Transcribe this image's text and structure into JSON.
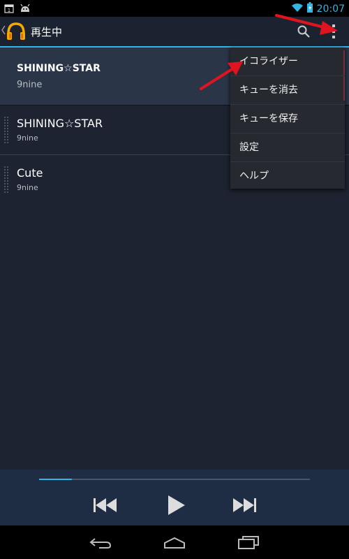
{
  "status_bar": {
    "time": "20:07",
    "notification_icons": [
      "calendar-icon",
      "android-icon"
    ],
    "system_icons": [
      "wifi-icon",
      "battery-charging-icon"
    ]
  },
  "action_bar": {
    "title": "再生中",
    "app_icon": "headphones-icon",
    "search_icon": "search-icon",
    "overflow_icon": "overflow-menu-icon"
  },
  "queue": [
    {
      "title": "SHINING☆STAR",
      "artist": "9nine",
      "playing": true
    },
    {
      "title": "SHINING☆STAR",
      "artist": "9nine",
      "playing": false
    },
    {
      "title": "Cute",
      "artist": "9nine",
      "playing": false
    }
  ],
  "overflow_menu": {
    "items": [
      {
        "label": "イコライザー"
      },
      {
        "label": "キューを消去"
      },
      {
        "label": "キューを保存"
      },
      {
        "label": "設定"
      },
      {
        "label": "ヘルプ"
      }
    ]
  },
  "player": {
    "progress": 0.12,
    "prev_icon": "skip-previous-icon",
    "play_icon": "play-icon",
    "next_icon": "skip-next-icon"
  },
  "nav_bar": {
    "back_icon": "back-icon",
    "home_icon": "home-icon",
    "recents_icon": "recent-apps-icon"
  },
  "colors": {
    "accent": "#33b5e5",
    "annotation_arrow": "#e0141e",
    "background": "#1d2330",
    "menu_bg": "#262a30"
  }
}
